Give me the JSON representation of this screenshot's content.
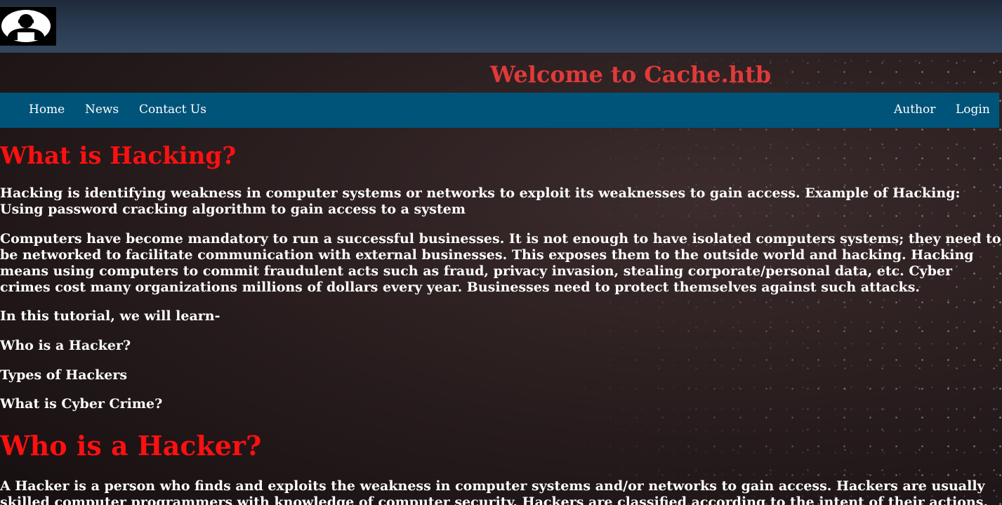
{
  "header": {
    "logo_icon": "hacker-icon",
    "title": "Welcome to Cache.htb"
  },
  "nav": {
    "left": [
      "Home",
      "News",
      "Contact Us"
    ],
    "right": [
      "Author",
      "Login"
    ]
  },
  "content": {
    "heading1": "What is Hacking?",
    "para1": "Hacking is identifying weakness in computer systems or networks to exploit its weaknesses to gain access. Example of Hacking: Using password cracking algorithm to gain access to a system",
    "para2": "Computers have become mandatory to run a successful businesses. It is not enough to have isolated computers systems; they need to be networked to facilitate communication with external businesses. This exposes them to the outside world and hacking. Hacking means using computers to commit fraudulent acts such as fraud, privacy invasion, stealing corporate/personal data, etc. Cyber crimes cost many organizations millions of dollars every year. Businesses need to protect themselves against such attacks.",
    "para3": "In this tutorial, we will learn-",
    "item1": "Who is a Hacker?",
    "item2": "Types of Hackers",
    "item3": "What is Cyber Crime?",
    "heading2": "Who is a Hacker?",
    "para4": "A Hacker is a person who finds and exploits the weakness in computer systems and/or networks to gain access. Hackers are usually skilled computer programmers with knowledge of computer security. Hackers are classified according to the intent of their actions."
  },
  "colors": {
    "title": "#e03a3a",
    "heading": "#ff1010",
    "navbar": "#005479"
  }
}
